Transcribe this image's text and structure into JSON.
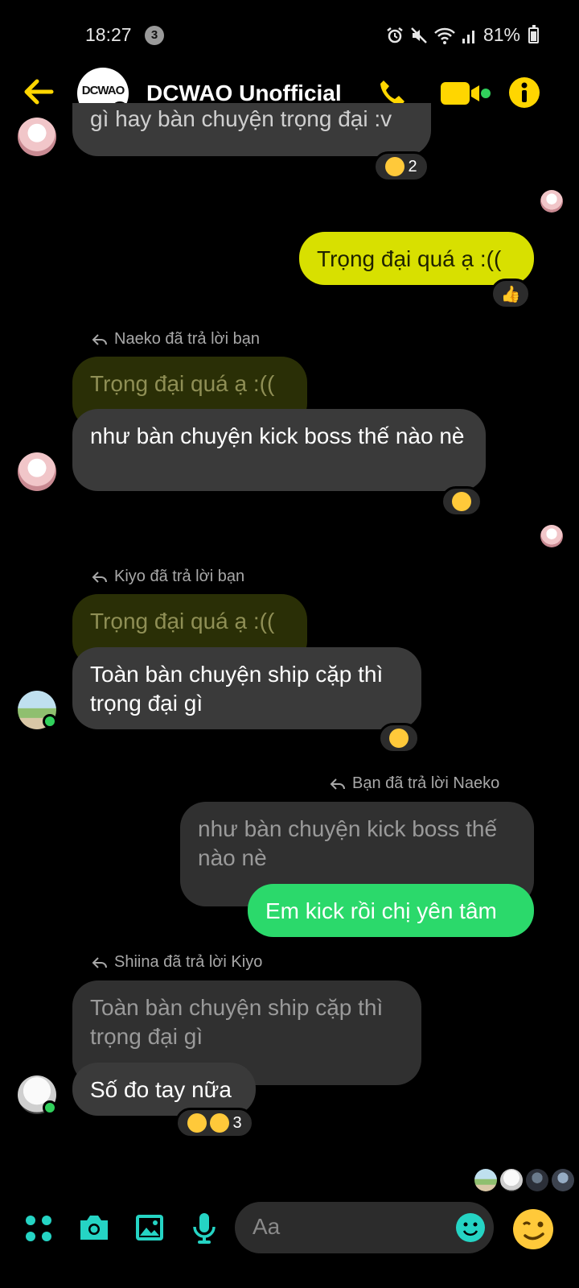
{
  "status_bar": {
    "time": "18:27",
    "notification_count": "3",
    "battery": "81%"
  },
  "header": {
    "title": "DCWAO Unofficial",
    "avatar_logo_text": "DCWAO"
  },
  "messages": {
    "top_partial": {
      "text": "gì hay bàn chuyện trọng đại :v",
      "reaction_count": "2"
    },
    "out_1": {
      "text": "Trọng đại quá ạ :(("
    },
    "reply_1": {
      "label": "Naeko đã trả lời bạn",
      "quoted": "Trọng đại quá ạ :((",
      "text": "như bàn chuyện kick boss thế nào nè"
    },
    "reply_2": {
      "label": "Kiyo đã trả lời bạn",
      "quoted": "Trọng đại quá ạ :((",
      "text": "Toàn bàn chuyện ship cặp thì trọng đại gì"
    },
    "reply_3": {
      "label": "Bạn đã trả lời Naeko",
      "quoted": "như bàn chuyện kick boss thế nào nè",
      "text": "Em kick rồi chị yên tâm"
    },
    "reply_4": {
      "label": "Shiina đã trả lời Kiyo",
      "quoted": "Toàn bàn chuyện ship cặp thì trọng đại gì",
      "text": "Số đo tay nữa",
      "reaction_count": "3"
    }
  },
  "composer": {
    "placeholder": "Aa"
  },
  "colors": {
    "accent": "#ffd600",
    "outgoing": "#d8e000",
    "sent_green": "#2bd96b",
    "teal_icons": "#25d4c4"
  }
}
